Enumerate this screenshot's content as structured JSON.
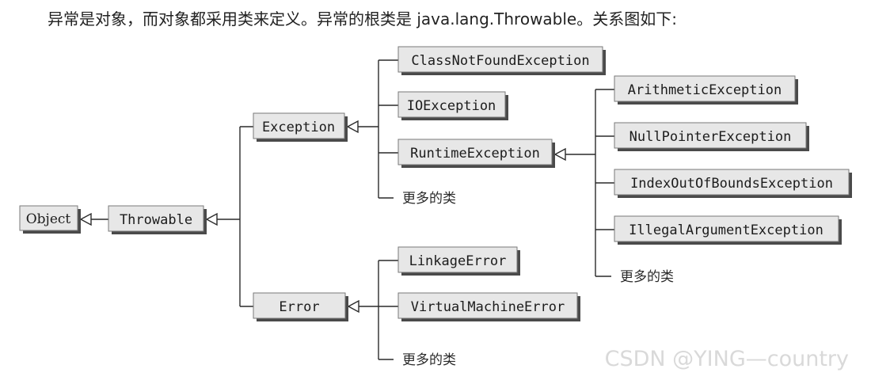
{
  "intro": "异常是对象，而对象都采用类来定义。异常的根类是 java.lang.Throwable。关系图如下:",
  "nodes": {
    "object": "Object",
    "throwable": "Throwable",
    "exception": "Exception",
    "error": "Error",
    "class_not_found": "ClassNotFoundException",
    "io_exception": "IOException",
    "runtime_exception": "RuntimeException",
    "arithmetic": "ArithmeticException",
    "null_pointer": "NullPointerException",
    "index_out_of_bounds": "IndexOutOfBoundsException",
    "illegal_argument": "IllegalArgumentException",
    "linkage_error": "LinkageError",
    "virtual_machine_error": "VirtualMachineError"
  },
  "more_classes": "更多的类",
  "watermark": "CSDN @YING—country",
  "colors": {
    "box_fill": "#e7e7e7",
    "shadow": "#4a4a4a",
    "line": "#2a2a2a"
  }
}
